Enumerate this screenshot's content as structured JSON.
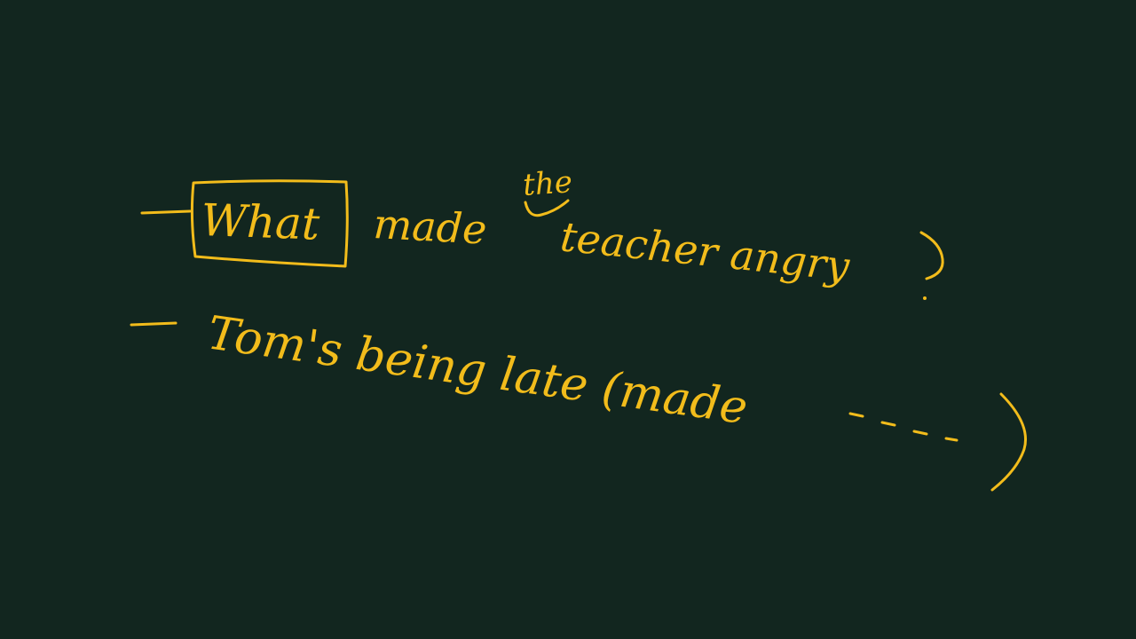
{
  "board": {
    "ink_color": "#f2bc1b",
    "background_color": "#12261f"
  },
  "line1": {
    "boxed_word": "What",
    "rest": "made",
    "inserted_word": "the",
    "after_insert": "teacher angry",
    "end_mark": "?"
  },
  "line2": {
    "text": "Tom's being late (made",
    "ellipsis": "...",
    "end_mark": ")"
  }
}
